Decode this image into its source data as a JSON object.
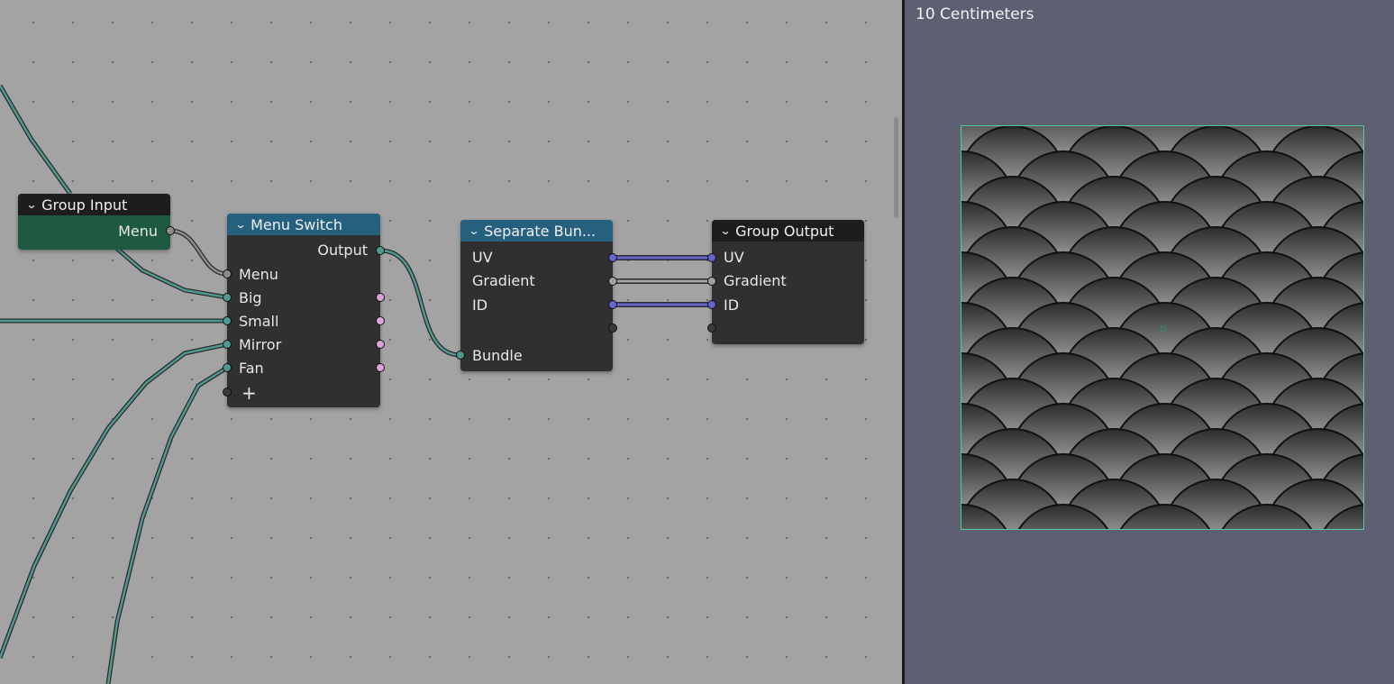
{
  "node_editor": {
    "nodes": {
      "group_input": {
        "title": "Group Input",
        "outputs": [
          "Menu"
        ]
      },
      "menu_switch": {
        "title": "Menu Switch",
        "output": "Output",
        "inputs": [
          "Menu",
          "Big",
          "Small",
          "Mirror",
          "Fan"
        ],
        "add_symbol": "+"
      },
      "separate_bundle": {
        "title": "Separate Bun...",
        "outputs": [
          "UV",
          "Gradient",
          "ID"
        ],
        "input": "Bundle"
      },
      "group_output": {
        "title": "Group Output",
        "inputs": [
          "UV",
          "Gradient",
          "ID"
        ]
      }
    },
    "colors": {
      "editor_bg": "#a3a3a3",
      "group_input_body": "#1e5a42",
      "header_blue": "#25617e",
      "socket_teal": "#4f9a90",
      "socket_vector": "#6565cf",
      "socket_pink": "#d9a4db"
    }
  },
  "viewer": {
    "scale_label": "10 Centimeters",
    "preview_pattern": "fish-scale",
    "border_color": "#57c7a3"
  }
}
